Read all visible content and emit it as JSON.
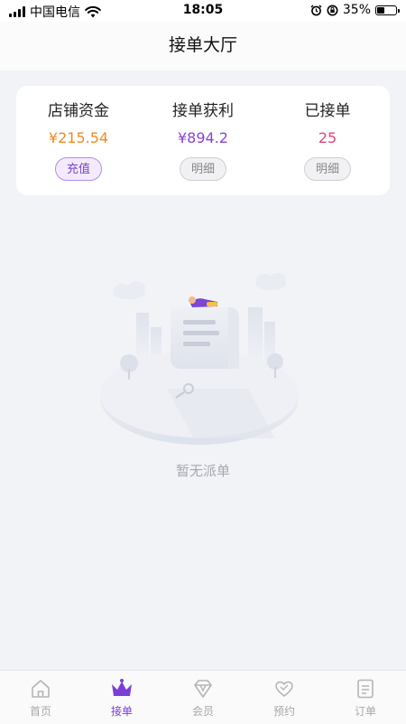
{
  "status_bar": {
    "carrier": "中国电信",
    "time": "18:05",
    "battery": "35%",
    "battery_level": 0.35
  },
  "header": {
    "title": "接单大厅"
  },
  "stats": [
    {
      "label": "店铺资金",
      "value": "¥215.54",
      "button": "充值",
      "color": "#f08a24"
    },
    {
      "label": "接单获利",
      "value": "¥894.2",
      "button": "明细",
      "color": "#8a44d6"
    },
    {
      "label": "已接单",
      "value": "25",
      "button": "明细",
      "color": "#e0457b"
    }
  ],
  "empty": {
    "text": "暂无派单"
  },
  "tabbar": {
    "active_color": "#7c3fd6",
    "items": [
      {
        "label": "首页",
        "icon": "home-icon"
      },
      {
        "label": "接单",
        "icon": "crown-icon"
      },
      {
        "label": "会员",
        "icon": "diamond-icon"
      },
      {
        "label": "预约",
        "icon": "heart-icon"
      },
      {
        "label": "订单",
        "icon": "document-icon"
      }
    ]
  }
}
